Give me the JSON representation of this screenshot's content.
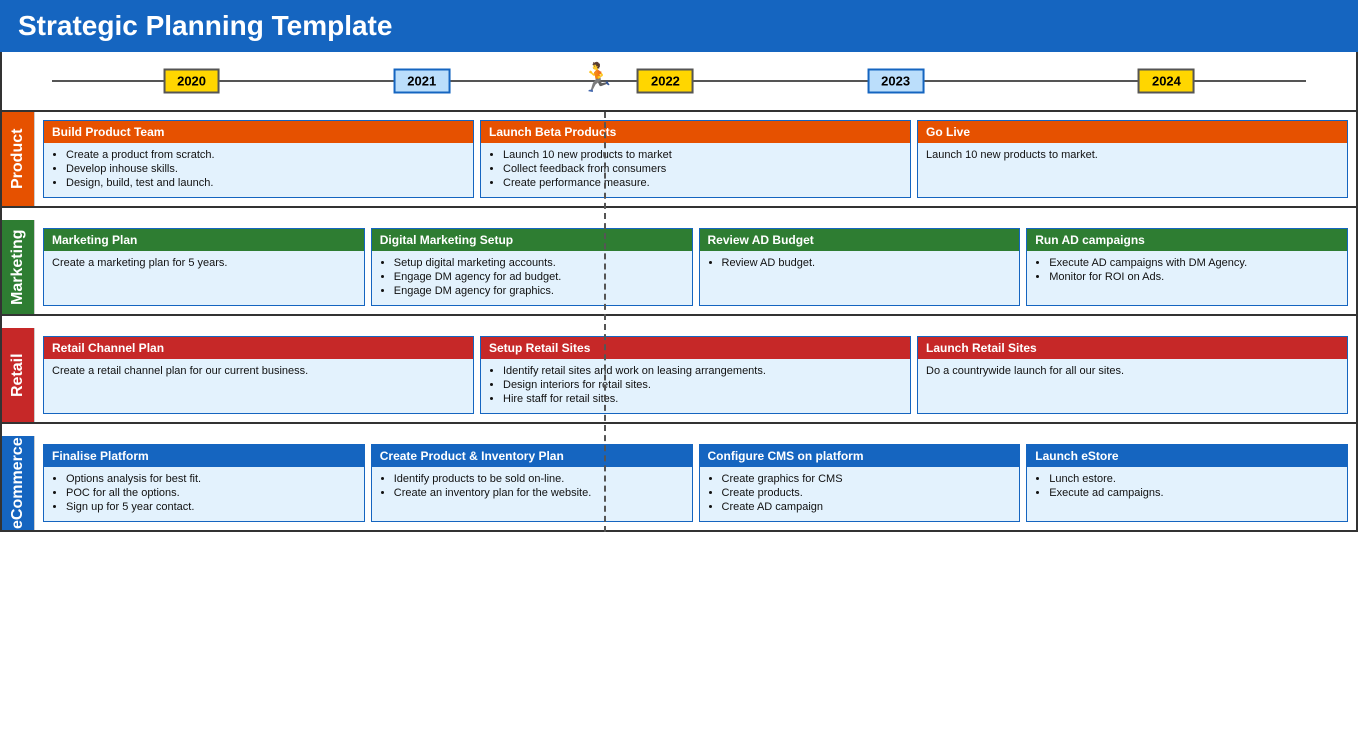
{
  "header": {
    "title": "Strategic Planning Template"
  },
  "timeline": {
    "years": [
      {
        "label": "2020",
        "style": "yellow",
        "left_pct": 14
      },
      {
        "label": "2021",
        "style": "blue",
        "left_pct": 31
      },
      {
        "label": "2022",
        "style": "yellow",
        "left_pct": 49
      },
      {
        "label": "2023",
        "style": "blue",
        "left_pct": 66
      },
      {
        "label": "2024",
        "style": "yellow",
        "left_pct": 86
      }
    ],
    "runner_left_pct": 44
  },
  "dashed_line_left_pct": 44.5,
  "rows": [
    {
      "id": "product",
      "label": "Product",
      "label_class": "row-label-product",
      "header_class": "card-header-orange",
      "cards": [
        {
          "title": "Build Product Team",
          "body_type": "bullets",
          "items": [
            "Create a product from scratch.",
            "Develop inhouse skills.",
            "Design, build, test and launch."
          ]
        },
        {
          "title": "Launch Beta Products",
          "body_type": "bullets",
          "items": [
            "Launch 10 new products to market",
            "Collect feedback from consumers",
            "Create performance measure."
          ]
        },
        {
          "title": "Go Live",
          "body_type": "text",
          "text": "Launch 10 new products to market."
        }
      ]
    },
    {
      "id": "marketing",
      "label": "Marketing",
      "label_class": "row-label-marketing",
      "header_class": "card-header-green",
      "cards": [
        {
          "title": "Marketing Plan",
          "body_type": "text",
          "text": "Create a marketing plan for 5 years."
        },
        {
          "title": "Digital Marketing Setup",
          "body_type": "bullets",
          "items": [
            "Setup digital marketing accounts.",
            "Engage DM agency for ad budget.",
            "Engage DM agency for graphics."
          ]
        },
        {
          "title": "Review AD Budget",
          "body_type": "bullets",
          "items": [
            "Review AD budget."
          ]
        },
        {
          "title": "Run AD campaigns",
          "body_type": "bullets",
          "items": [
            "Execute AD campaigns with DM Agency.",
            "Monitor for ROI on Ads."
          ]
        }
      ]
    },
    {
      "id": "retail",
      "label": "Retail",
      "label_class": "row-label-retail",
      "header_class": "card-header-red",
      "cards": [
        {
          "title": "Retail Channel Plan",
          "body_type": "text",
          "text": "Create a retail channel plan for our current business."
        },
        {
          "title": "Setup Retail Sites",
          "body_type": "bullets",
          "items": [
            "Identify retail sites and work on leasing arrangements.",
            "Design interiors for retail sites.",
            "Hire staff for retail sites."
          ]
        },
        {
          "title": "Launch Retail Sites",
          "body_type": "text",
          "text": "Do a countrywide launch for all our sites."
        }
      ]
    },
    {
      "id": "ecommerce",
      "label": "eCommerce",
      "label_class": "row-label-ecommerce",
      "header_class": "card-header-blue",
      "cards": [
        {
          "title": "Finalise Platform",
          "body_type": "bullets",
          "items": [
            "Options analysis for best fit.",
            "POC for all the options.",
            "Sign up for 5 year contact."
          ]
        },
        {
          "title": "Create Product & Inventory Plan",
          "body_type": "bullets",
          "items": [
            "Identify products to be sold on-line.",
            "Create an inventory plan for the website."
          ]
        },
        {
          "title": "Configure CMS on platform",
          "body_type": "bullets",
          "items": [
            "Create graphics for CMS",
            "Create products.",
            "Create AD campaign"
          ]
        },
        {
          "title": "Launch eStore",
          "body_type": "bullets",
          "items": [
            "Lunch estore.",
            "Execute ad campaigns."
          ]
        }
      ]
    }
  ]
}
